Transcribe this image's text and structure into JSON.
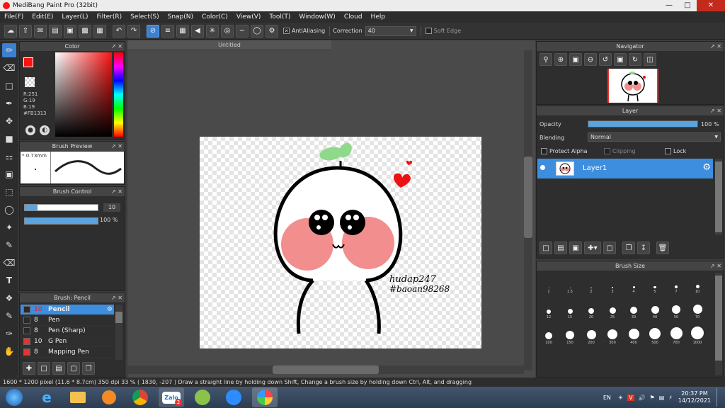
{
  "window": {
    "title": "MediBang Paint Pro (32bit)"
  },
  "menu": [
    "File(F)",
    "Edit(E)",
    "Layer(L)",
    "Filter(R)",
    "Select(S)",
    "Snap(N)",
    "Color(C)",
    "View(V)",
    "Tool(T)",
    "Window(W)",
    "Cloud",
    "Help"
  ],
  "toolbar": {
    "antialiasing_label": "AntiAliasing",
    "correction_label": "Correction",
    "correction_value": "40",
    "soft_edge_label": "Soft Edge"
  },
  "canvas": {
    "tab_title": "Untitled"
  },
  "color_panel": {
    "title": "Color",
    "r": "R:251",
    "g": "G:19",
    "b": "B:19",
    "hex": "#FB1313",
    "primary": "#fb1313"
  },
  "brush_preview": {
    "title": "Brush Preview",
    "size": "* 0.73mm"
  },
  "brush_control": {
    "title": "Brush Control",
    "size_value": "10",
    "opacity_value": "100 %"
  },
  "brush_list": {
    "title": "Brush: Pencil",
    "items": [
      {
        "size": "10",
        "name": "Pencil",
        "color": "#2a2a2a"
      },
      {
        "size": "8",
        "name": "Pen",
        "color": "#2a2a2a"
      },
      {
        "size": "8",
        "name": "Pen (Sharp)",
        "color": "#2a2a2a"
      },
      {
        "size": "10",
        "name": "G Pen",
        "color": "#e33333"
      },
      {
        "size": "8",
        "name": "Mapping Pen",
        "color": "#e33333"
      }
    ]
  },
  "navigator": {
    "title": "Navigator"
  },
  "layer_panel": {
    "title": "Layer",
    "opacity_label": "Opacity",
    "opacity_value": "100 %",
    "opacity_level": 1.0,
    "blending_label": "Blending",
    "blending_value": "Normal",
    "protect_alpha": "Protect Alpha",
    "clipping": "Clipping",
    "lock": "Lock",
    "layer_name": "Layer1"
  },
  "brush_size": {
    "title": "Brush Size",
    "sizes": [
      "1",
      "1.5",
      "2",
      "3",
      "4",
      "5",
      "7",
      "10",
      "12",
      "15",
      "20",
      "25",
      "30",
      "40",
      "50",
      "70",
      "100",
      "150",
      "200",
      "300",
      "400",
      "500",
      "700",
      "1000"
    ]
  },
  "artwork": {
    "text_line1": "hudap247",
    "text_line2": "#baoan98268"
  },
  "status": {
    "text": "1600 * 1200 pixel  (11.6 * 8.7cm)  350 dpi  33 %  ( 1830, -207 )  Draw a straight line by holding down Shift, Change a brush size by holding down Ctrl, Alt, and dragging"
  },
  "taskbar": {
    "lang": "EN",
    "time": "20:37 PM",
    "date": "14/12/2021",
    "zalo_badge": "2",
    "zalo_label": "Zalo"
  }
}
